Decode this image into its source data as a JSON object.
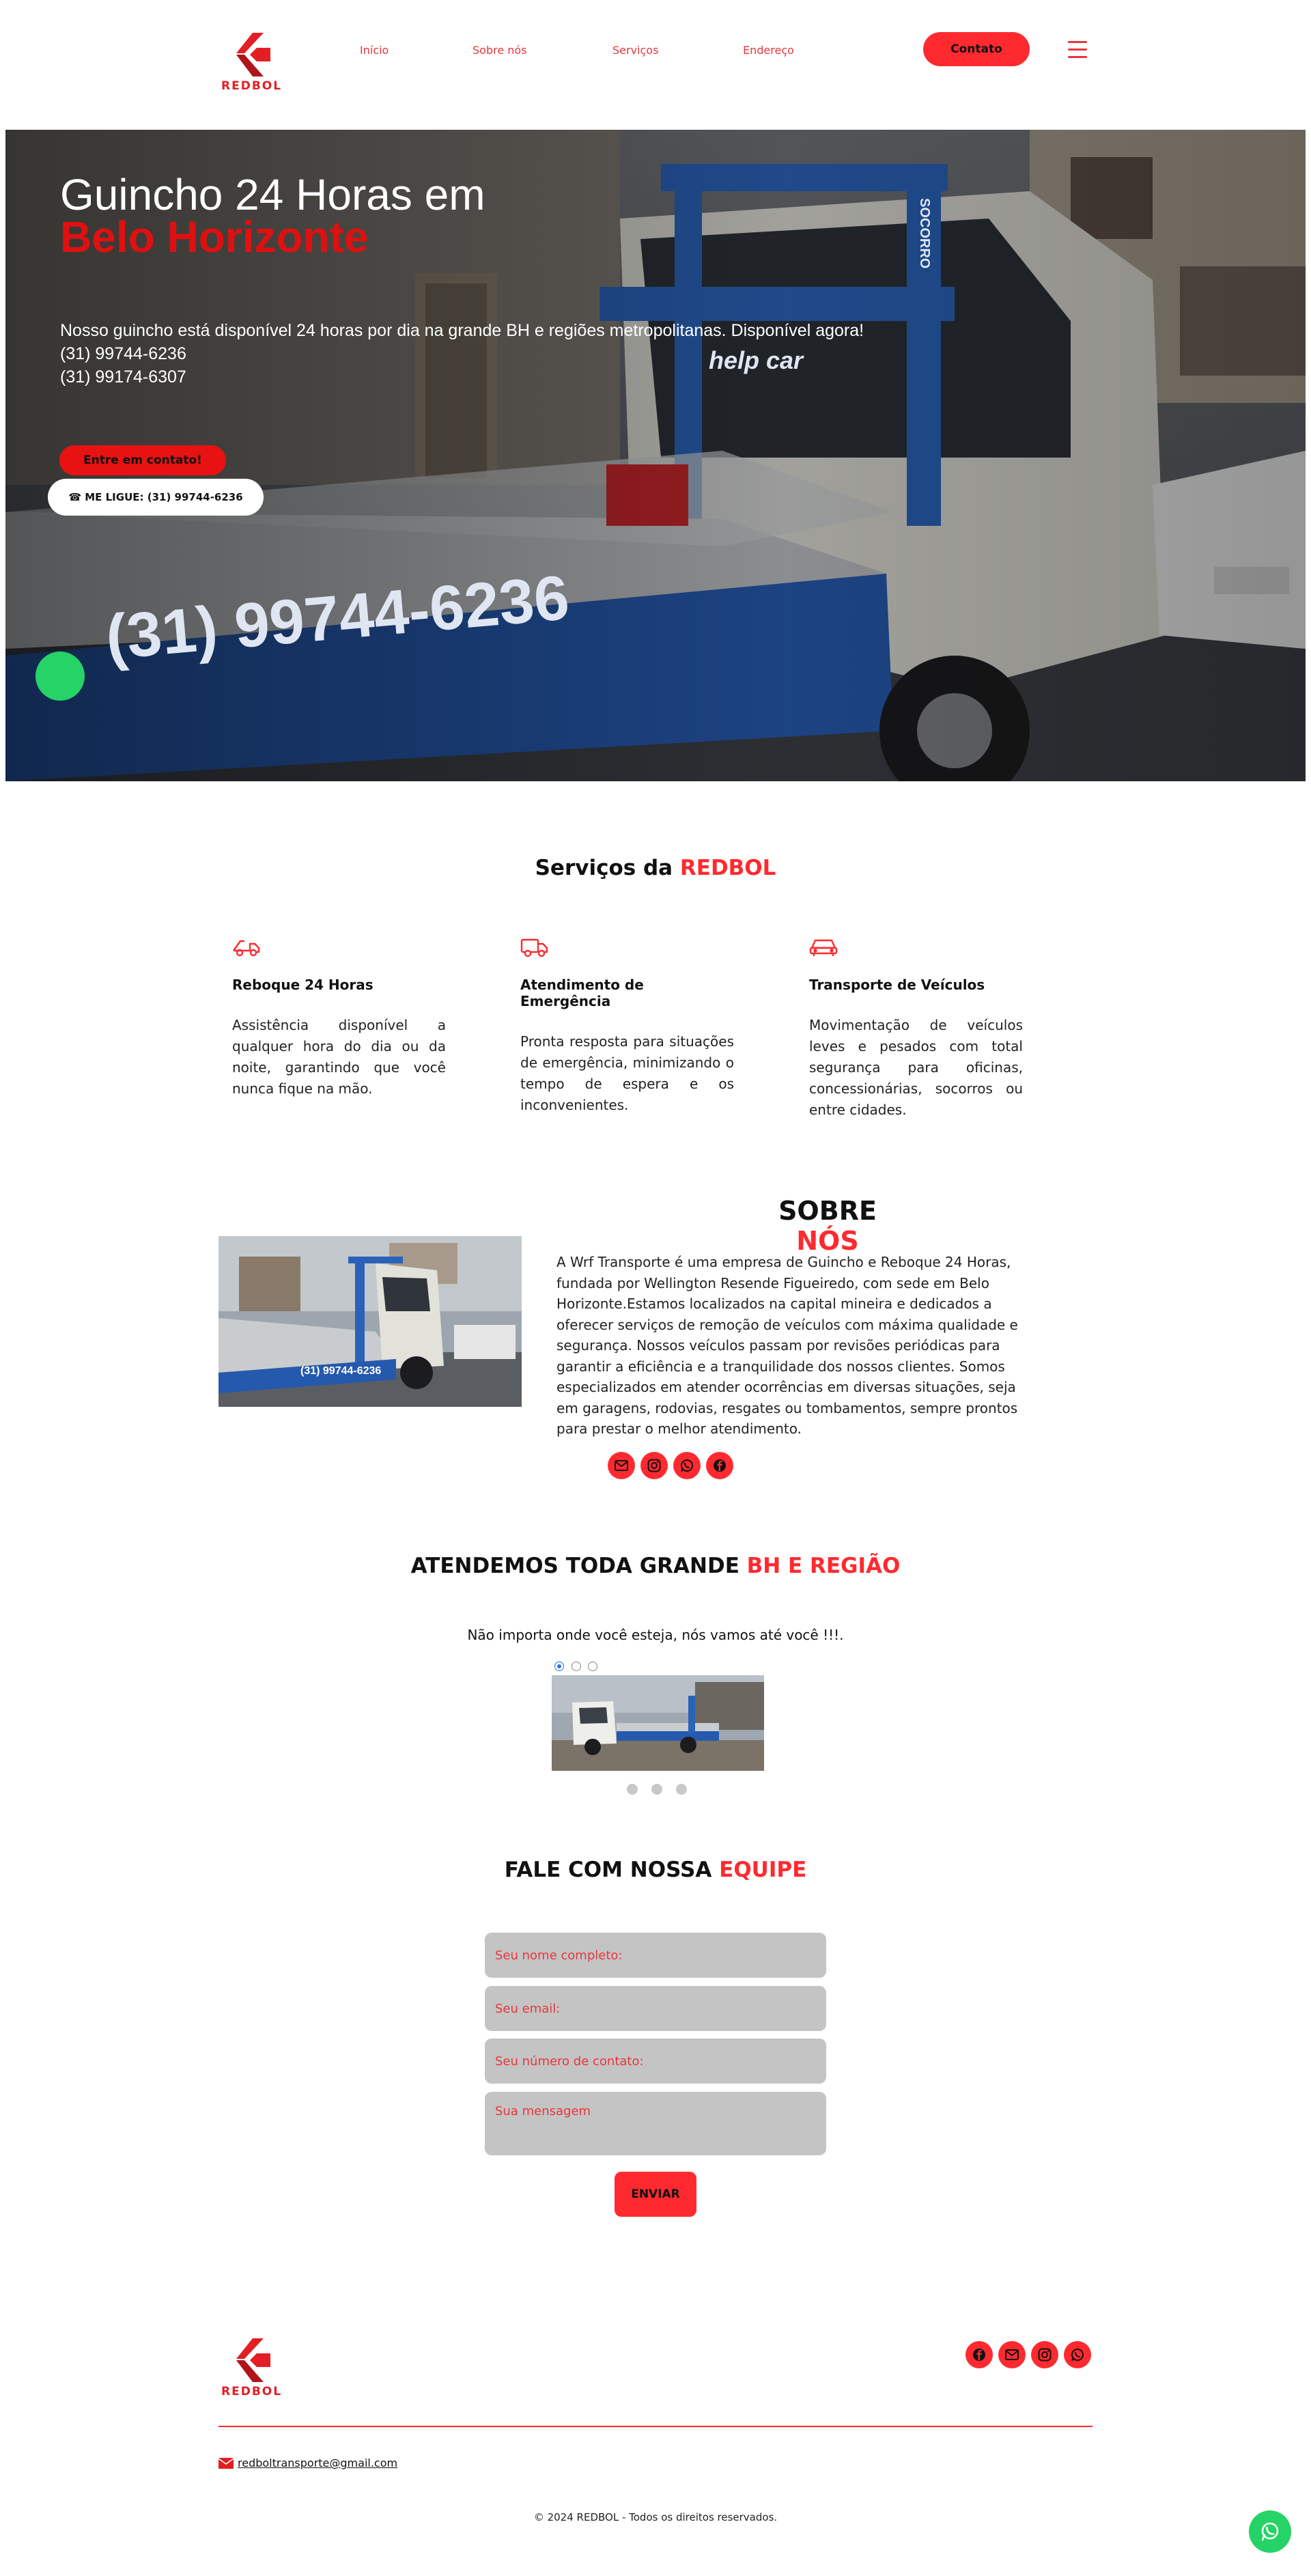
{
  "header": {
    "brand": "REDBOL",
    "nav": [
      "Início",
      "Sobre nós",
      "Serviços",
      "Endereço"
    ],
    "contact_label": "Contato"
  },
  "hero": {
    "title_line1": "Guincho 24 Horas em",
    "title_line2": "Belo Horizonte",
    "description": "Nosso guincho está disponível 24 horas por dia na grande BH e regiões metropolitanas. Disponível agora!",
    "phone1": "(31) 99744-6236",
    "phone2": "(31) 99174-6307",
    "cta_primary": "Entre em contato!",
    "cta_call": "☎ ME LIGUE: (31) 99744-6236",
    "truck_phone": "(31) 99744-6236",
    "truck_brand": "help car",
    "truck_side": "SOCORRO"
  },
  "services": {
    "title": "Serviços da",
    "title_accent": "REDBOL",
    "items": [
      {
        "icon": "tow-truck-icon",
        "title": "Reboque 24 Horas",
        "text": "Assistência disponível a qualquer hora do dia ou da noite, garantindo que você nunca fique na mão."
      },
      {
        "icon": "truck-icon",
        "title": "Atendimento de Emergência",
        "text": "Pronta resposta para situações de emergência, minimizando o tempo de espera e os inconvenientes."
      },
      {
        "icon": "car-icon",
        "title": "Transporte de Veículos",
        "text": "Movimentação de veículos leves e pesados com total segurança para oficinas, concessionárias, socorros ou entre cidades."
      }
    ]
  },
  "about": {
    "title": "SOBRE",
    "title_accent": "NÓS",
    "text": "A Wrf Transporte é uma empresa de Guincho e Reboque 24 Horas, fundada por Wellington Resende Figueiredo, com sede em Belo Horizonte.Estamos localizados na capital mineira e dedicados a oferecer serviços de remoção de veículos com máxima qualidade e segurança. Nossos veículos passam por revisões periódicas para garantir a eficiência e a tranquilidade dos nossos clientes. Somos especializados em atender ocorrências em diversas situações, seja em garagens, rodovias, resgates ou tombamentos, sempre prontos para prestar o melhor atendimento.",
    "social_icons": [
      "mail-icon",
      "instagram-icon",
      "whatsapp-icon",
      "facebook-icon"
    ]
  },
  "region": {
    "title": "ATENDEMOS TODA GRANDE",
    "title_accent": "BH E REGIÃO",
    "subtitle": "Não importa onde você esteja, nós vamos até você !!!.",
    "slides_count": 3,
    "active_slide": 1
  },
  "contact": {
    "title": "FALE COM NOSSA",
    "title_accent": "EQUIPE",
    "name_placeholder": "Seu nome completo:",
    "email_placeholder": "Seu email:",
    "phone_placeholder": "Seu número de contato:",
    "message_placeholder": "Sua mensagem",
    "send_label": "ENVIAR"
  },
  "footer": {
    "brand": "REDBOL",
    "email": "redboltransporte@gmail.com",
    "copyright": "© 2024 REDBOL - Todos os direitos reservados.",
    "social_icons": [
      "facebook-icon",
      "mail-icon",
      "instagram-icon",
      "whatsapp-icon"
    ]
  },
  "colors": {
    "accent": "#ff2a2f",
    "brand_red": "#e31e24",
    "whatsapp": "#25d366",
    "input_bg": "#c4c4c4"
  }
}
